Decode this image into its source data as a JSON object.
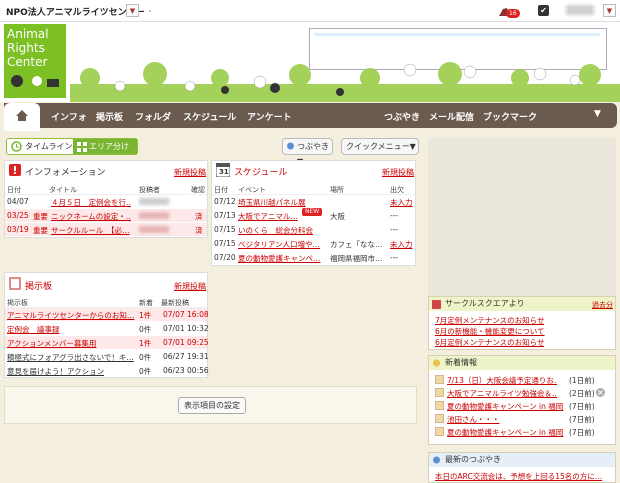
{
  "topbar": {
    "org": "NPO法人アニマルライツセンター",
    "sep": "・",
    "badge": "16",
    "dd": "▼",
    "check": "✔"
  },
  "logo": {
    "l1": "Animal",
    "l2": "Rights",
    "l3": "Center"
  },
  "nav": {
    "items": [
      "インフォ",
      "掲示板",
      "フォルダ",
      "スケジュール",
      "アンケート",
      "つぶやき",
      "メール配信",
      "ブックマーク"
    ],
    "more": "▼"
  },
  "toolbar": {
    "timeline": "タイムライン",
    "area": "エリア分け",
    "tweet": "つぶやき▼",
    "quick": "クイックメニュー▼"
  },
  "info": {
    "title": "インフォメーション",
    "new_post": "新規投稿",
    "headers": [
      "日付",
      "タイトル",
      "投稿者",
      "確認"
    ],
    "rows": [
      {
        "date": "04/07",
        "tag": "",
        "title": "４月５日　定例会を行…",
        "ok": ""
      },
      {
        "date": "03/25",
        "tag": "重要",
        "title": "ニックネームの設定・…",
        "ok": "済"
      },
      {
        "date": "03/19",
        "tag": "重要",
        "title": "サークルルール　【必…",
        "ok": "済"
      }
    ]
  },
  "schedule": {
    "title": "スケジュール",
    "new_post": "新規投稿",
    "day": "31",
    "headers": [
      "日付",
      "イベント",
      "場所",
      "出欠"
    ],
    "rows": [
      {
        "date": "07/12",
        "event": "埼玉県川越パネル展",
        "place": "",
        "att": "未入力"
      },
      {
        "date": "07/13",
        "event": "大阪でアニマル…",
        "place": "大阪",
        "att": "---"
      },
      {
        "date": "07/15",
        "event": "いのくら　総会分科会",
        "place": "",
        "att": "---"
      },
      {
        "date": "07/15",
        "event": "ベジタリアン人口増や…",
        "place": "カフェ「なな…",
        "att": "未入力"
      },
      {
        "date": "07/20",
        "event": "夏の動物愛護キャンペ…",
        "place": "福岡県福岡市…",
        "att": "---"
      }
    ],
    "new_badge": "NEW"
  },
  "board": {
    "title": "掲示板",
    "new_post": "新規投稿",
    "headers": [
      "掲示板",
      "新着",
      "最新投稿"
    ],
    "rows": [
      {
        "title": "アニマルライツセンターからのお知…",
        "count": "1件",
        "date": "07/07",
        "time": "16:08",
        "hl": true
      },
      {
        "title": "定例会　議事録",
        "count": "0件",
        "date": "07/01",
        "time": "10:32",
        "hl": false
      },
      {
        "title": "アクションメンバー募集用",
        "count": "1件",
        "date": "07/01",
        "time": "09:25",
        "hl": true
      },
      {
        "title": "積極式にフォアグラ出さないで！キ…",
        "count": "0件",
        "date": "06/27",
        "time": "19:31",
        "hl": false
      },
      {
        "title": "意見を届けよう！アクション",
        "count": "0件",
        "date": "06/23",
        "time": "00:56",
        "hl": false
      }
    ]
  },
  "settings": "表示項目の設定",
  "circle": {
    "title": "サークルスクエアより",
    "more": "過去分",
    "items": [
      "7月定例メンテナンスのお知らせ",
      "6月の新機能・機能変更について",
      "6月定例メンテナンスのお知らせ"
    ]
  },
  "news": {
    "title": "新着情報",
    "items": [
      {
        "text": "7/13（日）大阪会議予定通りお…",
        "ago": "(1日前)"
      },
      {
        "text": "大阪でアニマルライツ勉強会＆…",
        "ago": "(2日前)"
      },
      {
        "text": "夏の動物愛護キャンペーン in 福岡",
        "ago": "(7日前)"
      },
      {
        "text": "池田さん・・・",
        "ago": "(7日前)"
      },
      {
        "text": "夏の動物愛護キャンペーン in 福岡",
        "ago": "(7日前)"
      }
    ]
  },
  "tweets": {
    "title": "最新のつぶやき",
    "text": "本日のARC交流会は、予想を上回る15名の方に…"
  },
  "colors": {
    "accent": "#7cc024",
    "nav": "#6b5b4e",
    "link": "#c00000"
  }
}
